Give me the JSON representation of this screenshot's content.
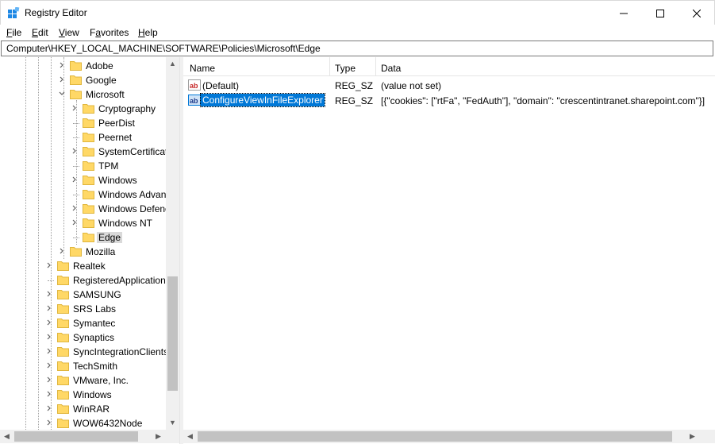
{
  "window": {
    "title": "Registry Editor"
  },
  "menu": [
    "File",
    "Edit",
    "View",
    "Favorites",
    "Help"
  ],
  "menu_underline": [
    "F",
    "E",
    "V",
    "a",
    "H"
  ],
  "address": "Computer\\HKEY_LOCAL_MACHINE\\SOFTWARE\\Policies\\Microsoft\\Edge",
  "tree": [
    {
      "label": "Adobe",
      "indent": 2,
      "expander": "collapsed"
    },
    {
      "label": "Google",
      "indent": 2,
      "expander": "collapsed"
    },
    {
      "label": "Microsoft",
      "indent": 2,
      "expander": "expanded"
    },
    {
      "label": "Cryptography",
      "indent": 3,
      "expander": "collapsed"
    },
    {
      "label": "PeerDist",
      "indent": 3,
      "expander": "none"
    },
    {
      "label": "Peernet",
      "indent": 3,
      "expander": "none"
    },
    {
      "label": "SystemCertificat",
      "indent": 3,
      "expander": "collapsed"
    },
    {
      "label": "TPM",
      "indent": 3,
      "expander": "none"
    },
    {
      "label": "Windows",
      "indent": 3,
      "expander": "collapsed"
    },
    {
      "label": "Windows Advan",
      "indent": 3,
      "expander": "none"
    },
    {
      "label": "Windows Defenc",
      "indent": 3,
      "expander": "collapsed"
    },
    {
      "label": "Windows NT",
      "indent": 3,
      "expander": "collapsed"
    },
    {
      "label": "Edge",
      "indent": 3,
      "expander": "none",
      "selected": true
    },
    {
      "label": "Mozilla",
      "indent": 2,
      "expander": "collapsed"
    },
    {
      "label": "Realtek",
      "indent": 1,
      "expander": "collapsed"
    },
    {
      "label": "RegisteredApplication",
      "indent": 1,
      "expander": "none"
    },
    {
      "label": "SAMSUNG",
      "indent": 1,
      "expander": "collapsed"
    },
    {
      "label": "SRS Labs",
      "indent": 1,
      "expander": "collapsed"
    },
    {
      "label": "Symantec",
      "indent": 1,
      "expander": "collapsed"
    },
    {
      "label": "Synaptics",
      "indent": 1,
      "expander": "collapsed"
    },
    {
      "label": "SyncIntegrationClients",
      "indent": 1,
      "expander": "collapsed"
    },
    {
      "label": "TechSmith",
      "indent": 1,
      "expander": "collapsed"
    },
    {
      "label": "VMware, Inc.",
      "indent": 1,
      "expander": "collapsed"
    },
    {
      "label": "Windows",
      "indent": 1,
      "expander": "collapsed"
    },
    {
      "label": "WinRAR",
      "indent": 1,
      "expander": "collapsed"
    },
    {
      "label": "WOW6432Node",
      "indent": 1,
      "expander": "collapsed"
    }
  ],
  "columns": {
    "name": "Name",
    "type": "Type",
    "data": "Data"
  },
  "values": [
    {
      "name": "(Default)",
      "type": "REG_SZ",
      "data": "(value not set)",
      "selected": false
    },
    {
      "name": "ConfigureViewInFileExplorer",
      "type": "REG_SZ",
      "data": "[{\"cookies\": [\"rtFa\", \"FedAuth\"], \"domain\": \"crescentintranet.sharepoint.com\"}]",
      "selected": true
    }
  ],
  "icons": {
    "app": "registry-editor-icon",
    "folder": "folder-icon",
    "value": "string-value-icon"
  },
  "colors": {
    "selection": "#0078d7",
    "folder": "#ffd866",
    "tree_selected": "#d9d9d9"
  }
}
